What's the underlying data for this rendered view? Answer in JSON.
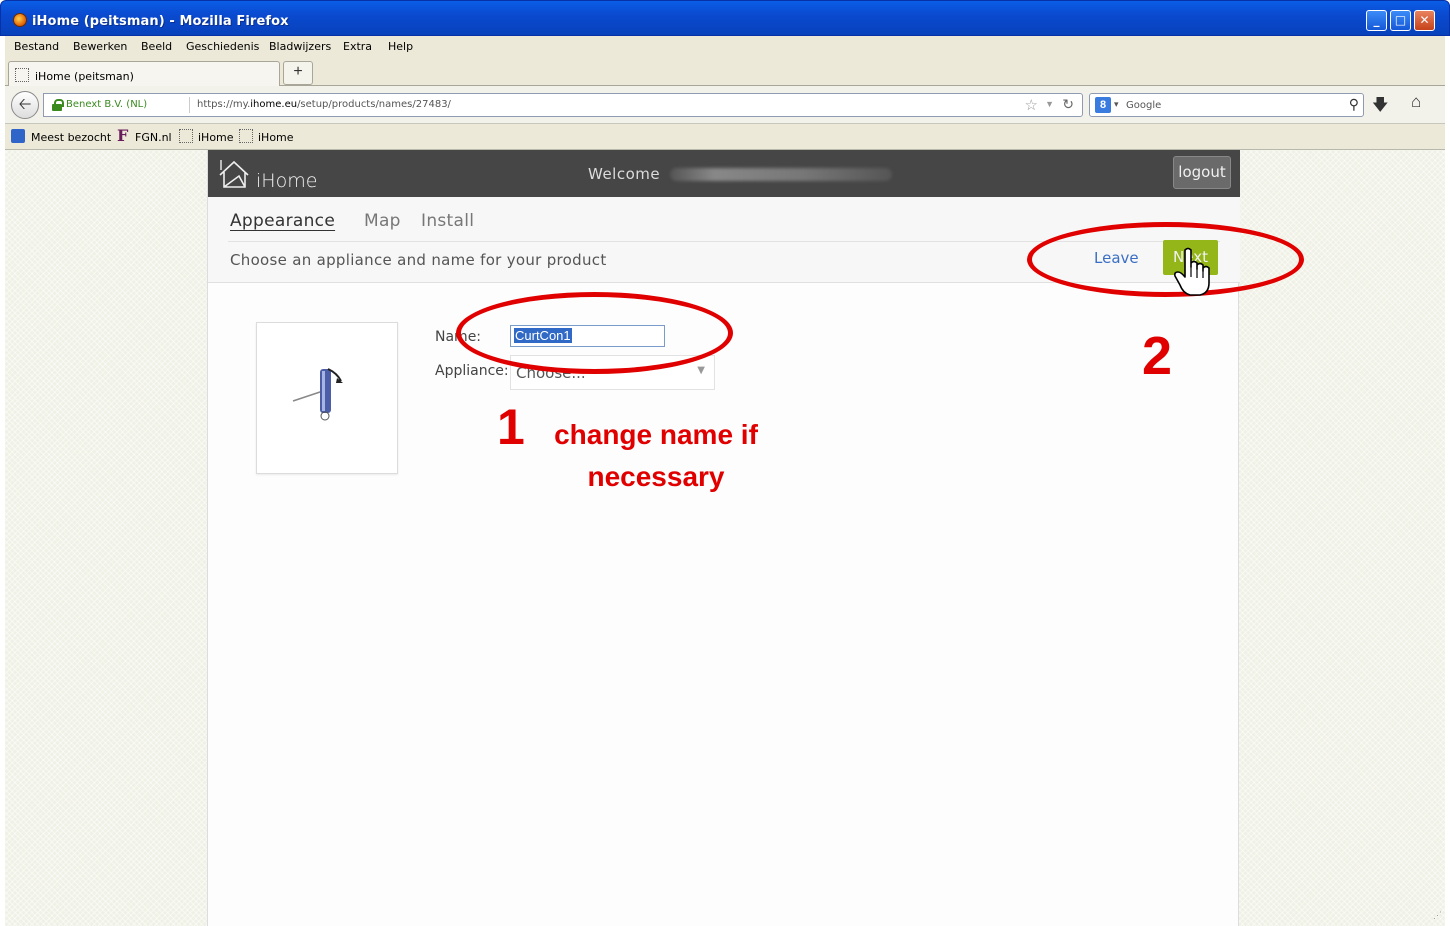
{
  "window": {
    "title": "iHome (peitsman) - Mozilla Firefox",
    "buttons": {
      "minimize": "_",
      "maximize": "□",
      "close": "✕"
    }
  },
  "menubar": {
    "items": [
      "Bestand",
      "Bewerken",
      "Beeld",
      "Geschiedenis",
      "Bladwijzers",
      "Extra",
      "Help"
    ]
  },
  "tabs": {
    "active_label": "iHome (peitsman)",
    "new_tab_label": "+"
  },
  "navbar": {
    "identity": "Benext B.V. (NL)",
    "url_prefix": "https://my.",
    "url_domain": "ihome.eu",
    "url_path": "/setup/products/names/27483/",
    "search_placeholder": "Google"
  },
  "bookmarks": {
    "items": [
      "Meest bezocht",
      "FGN.nl",
      "iHome",
      "iHome"
    ]
  },
  "site": {
    "logo_text": "iHome",
    "welcome": "Welcome",
    "logout_label": "logout",
    "nav_tabs": [
      "Appearance",
      "Map",
      "Install"
    ],
    "instruction": "Choose an appliance and name for your product",
    "leave_label": "Leave",
    "next_label": "Next"
  },
  "form": {
    "name_label": "Name:",
    "name_value": "CurtCon1",
    "appliance_label": "Appliance:",
    "appliance_value": "Choose..."
  },
  "annotations": {
    "step1_number": "1",
    "step1_text_line1": "change name if",
    "step1_text_line2": "necessary",
    "step2_number": "2",
    "color": "#e00000"
  },
  "colors": {
    "header_bg": "#464646",
    "next_button": "#94b619",
    "link": "#3a6fc4"
  }
}
